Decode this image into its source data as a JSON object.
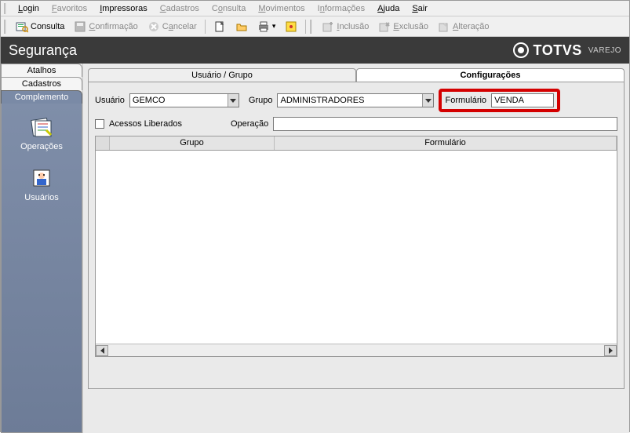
{
  "menubar": {
    "login": "Login",
    "favoritos": "Favoritos",
    "impressoras": "Impressoras",
    "cadastros": "Cadastros",
    "consulta": "Consulta",
    "movimentos": "Movimentos",
    "informacoes": "Informações",
    "ajuda": "Ajuda",
    "sair": "Sair"
  },
  "toolbar": {
    "consulta": "Consulta",
    "confirmacao": "Confirmação",
    "cancelar": "Cancelar",
    "inclusao": "Inclusão",
    "exclusao": "Exclusão",
    "alteracao": "Alteração"
  },
  "header": {
    "title": "Segurança",
    "brand": "TOTVS",
    "brand_sub": "VAREJO"
  },
  "left_tabs": {
    "atalhos": "Atalhos",
    "cadastros": "Cadastros",
    "complemento": "Complemento"
  },
  "sidebar": {
    "operacoes": "Operações",
    "usuarios": "Usuários"
  },
  "tabs": {
    "usuario_grupo": "Usuário  / Grupo",
    "configuracoes": "Configurações"
  },
  "form": {
    "usuario_label": "Usuário",
    "usuario_value": "GEMCO",
    "grupo_label": "Grupo",
    "grupo_value": "ADMINISTRADORES",
    "formulario_label": "Formulário",
    "formulario_value": "VENDA",
    "acessos_liberados": "Acessos Liberados",
    "operacao_label": "Operação",
    "operacao_value": ""
  },
  "grid": {
    "col_grupo": "Grupo",
    "col_formulario": "Formulário"
  }
}
